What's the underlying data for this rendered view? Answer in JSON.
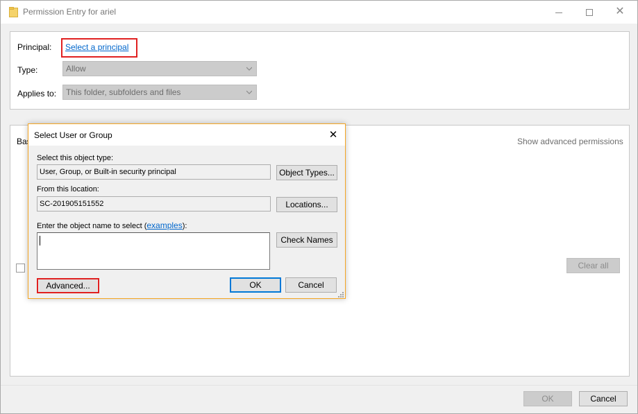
{
  "window": {
    "title": "Permission Entry for ariel",
    "icon": "folder-icon",
    "controls": {
      "minimize": "minimize-icon",
      "maximize": "maximize-icon",
      "close": "✕"
    }
  },
  "form": {
    "principal_label": "Principal:",
    "principal_link": "Select a principal",
    "type_label": "Type:",
    "type_value": "Allow",
    "applies_label": "Applies to:",
    "applies_value": "This folder, subfolders and files",
    "basic_label_partial": "Bas"
  },
  "permissions": {
    "show_advanced": "Show advanced permissions",
    "clear_all": "Clear all"
  },
  "footer": {
    "ok": "OK",
    "cancel": "Cancel"
  },
  "dialog": {
    "title": "Select User or Group",
    "close": "✕",
    "object_type_label": "Select this object type:",
    "object_type_value": "User, Group, or Built-in security principal",
    "object_types_button": "Object Types...",
    "location_label": "From this location:",
    "location_value": "SC-201905151552",
    "locations_button": "Locations...",
    "enter_name_prefix": "Enter the object name to select (",
    "examples_link": "examples",
    "enter_name_suffix": "):",
    "object_name_value": "",
    "check_names_button": "Check Names",
    "advanced_button": "Advanced...",
    "ok_button": "OK",
    "cancel_button": "Cancel"
  },
  "colors": {
    "highlight": "#e02020",
    "link": "#0066cc",
    "dialog_border": "#f5a623",
    "default_button_border": "#0078d7"
  }
}
